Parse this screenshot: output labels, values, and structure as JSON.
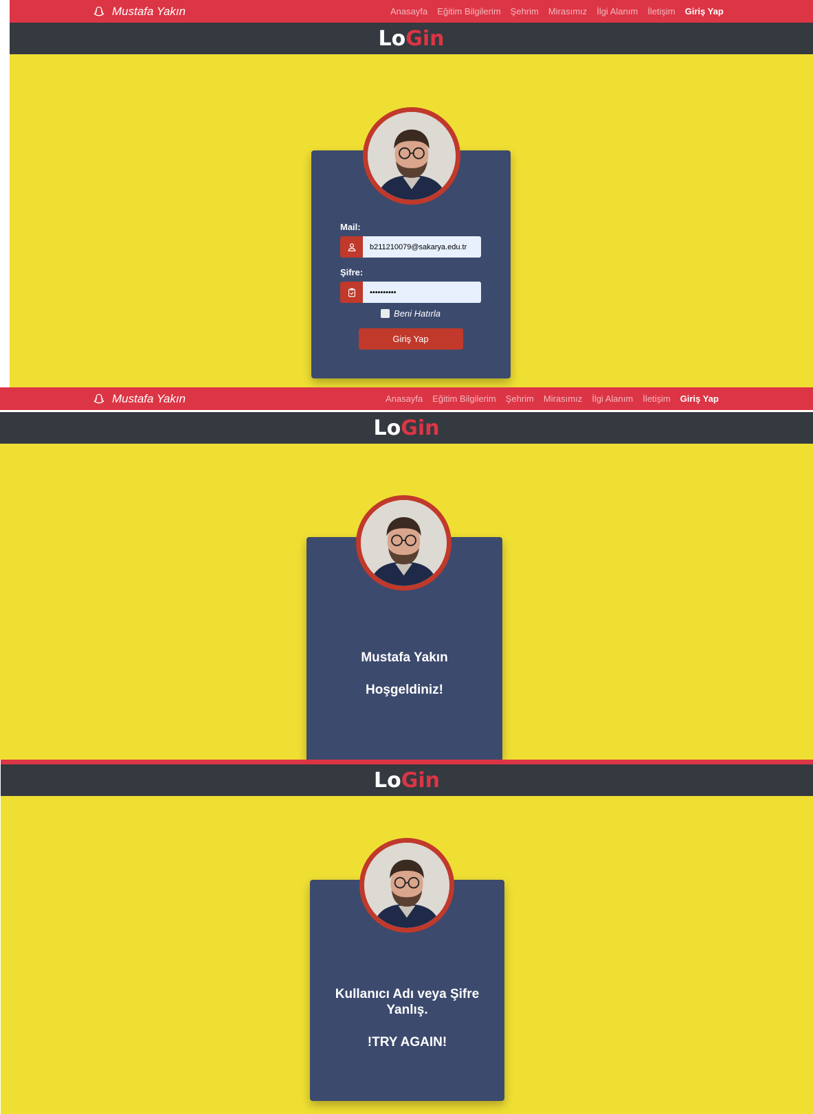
{
  "navbar": {
    "brand": "Mustafa Yakın",
    "links": [
      "Anasayfa",
      "Eğitim Bilgilerim",
      "Şehrim",
      "Mirasımız",
      "İlgi Alanım",
      "İletişim"
    ],
    "active_link": "Giriş Yap"
  },
  "header": {
    "title_part1": "Lo",
    "title_part2": "Gin"
  },
  "colors": {
    "navbar": "#dc3545",
    "header": "#343a40",
    "background": "#f0df33",
    "card": "#3c4a6d",
    "accent": "#c0392b",
    "title_accent": "#dc3545"
  },
  "login_form": {
    "mail_label": "Mail:",
    "mail_value": "b211210079@sakarya.edu.tr",
    "password_label": "Şifre:",
    "password_value": "••••••••••",
    "remember_label": "Beni Hatırla",
    "submit_label": "Giriş Yap"
  },
  "success": {
    "name": "Mustafa Yakın",
    "message": "Hoşgeldiniz!"
  },
  "error": {
    "message": "Kullanıcı Adı veya Şifre Yanlış.",
    "retry": "!TRY AGAIN!"
  },
  "icons": {
    "brand": "snapchat-ghost-icon",
    "mail": "user-icon",
    "password": "clipboard-check-icon"
  }
}
